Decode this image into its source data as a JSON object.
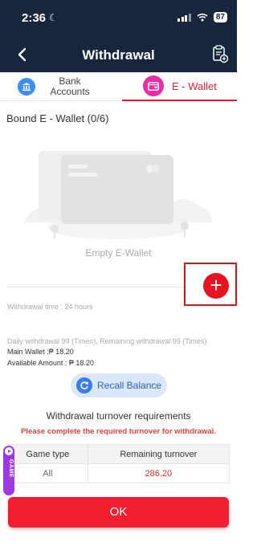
{
  "status_bar": {
    "time": "2:36",
    "battery": "87"
  },
  "header": {
    "title": "Withdrawal"
  },
  "tabs": [
    {
      "label": "Bank Accounts",
      "active": false
    },
    {
      "label": "E - Wallet",
      "active": true
    }
  ],
  "wallet": {
    "bound_title": "Bound E - Wallet (0/6)",
    "empty_label": "Empty E-Wallet"
  },
  "info": {
    "withdrawal_time": "Withdrawal time :  24 hours",
    "daily": "Daily withdrawal 99 (Times), Remaining withdrawal 99 (Times)",
    "main_wallet": "Main Wallet :₱ 18.20",
    "available": "Available Amount : ₱ 18.20"
  },
  "recall": {
    "label": "Recall Balance"
  },
  "turnover": {
    "title": "Withdrawal turnover requirements",
    "warning": "Please complete the required turnover for withdrawal.",
    "headers": [
      "Game type",
      "Remaining turnover"
    ],
    "rows": [
      {
        "game_type": "All",
        "remaining": "286.20"
      }
    ]
  },
  "game_tab": {
    "label": "GAME"
  },
  "ok_button": {
    "label": "OK"
  },
  "colors": {
    "header_bg": "#17263d",
    "accent": "#e02030",
    "ok": "#f21f33"
  }
}
